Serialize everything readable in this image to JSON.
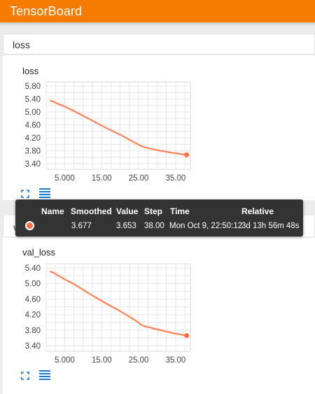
{
  "app": {
    "title": "TensorBoard"
  },
  "colors": {
    "accent": "#f57c00",
    "series": "#ff7043",
    "tooltip_bg": "#333333"
  },
  "sections": [
    {
      "header": "loss",
      "cards": [
        {
          "title": "loss"
        }
      ]
    },
    {
      "header": "val_loss",
      "cards": [
        {
          "title": "val_loss"
        }
      ]
    }
  ],
  "icons": {
    "expand": "fit-to-data-icon",
    "data": "toggle-data-table-icon"
  },
  "tooltip": {
    "headers": [
      "Name",
      "Smoothed",
      "Value",
      "Step",
      "Time",
      "Relative"
    ],
    "row": {
      "name": "",
      "smoothed": "3.677",
      "value": "3.653",
      "step": "38.00",
      "time": "Mon Oct 9, 22:50:12",
      "relative": "3d 13h 56m 48s"
    }
  },
  "chart_data": [
    {
      "type": "line",
      "title": "loss",
      "x_ticks": [
        "5.000",
        "15.00",
        "25.00",
        "35.00"
      ],
      "y_ticks": [
        "5.80",
        "5.40",
        "5.00",
        "4.60",
        "4.20",
        "3.80",
        "3.40"
      ],
      "xlim": [
        0,
        39
      ],
      "ylim": [
        3.3,
        5.9
      ],
      "grid": true,
      "series": [
        {
          "x": [
            1,
            2,
            3,
            5,
            8,
            12,
            16,
            20,
            24,
            26,
            30,
            34,
            38
          ],
          "y": [
            5.35,
            5.32,
            5.26,
            5.17,
            5.0,
            4.76,
            4.52,
            4.3,
            4.05,
            3.93,
            3.82,
            3.74,
            3.677
          ]
        }
      ],
      "highlight": {
        "x": 38,
        "y": 3.677
      }
    },
    {
      "type": "line",
      "title": "val_loss",
      "x_ticks": [
        "5.000",
        "15.00",
        "25.00",
        "35.00"
      ],
      "y_ticks": [
        "5.40",
        "5.00",
        "4.60",
        "4.20",
        "3.80",
        "3.40"
      ],
      "xlim": [
        0,
        39
      ],
      "ylim": [
        3.3,
        5.55
      ],
      "grid": true,
      "series": [
        {
          "x": [
            1,
            2,
            3,
            5,
            8,
            12,
            16,
            20,
            24,
            26,
            30,
            34,
            38
          ],
          "y": [
            5.31,
            5.28,
            5.22,
            5.11,
            4.96,
            4.72,
            4.5,
            4.29,
            4.06,
            3.92,
            3.82,
            3.73,
            3.66
          ]
        }
      ],
      "highlight": {
        "x": 38,
        "y": 3.66
      }
    }
  ]
}
